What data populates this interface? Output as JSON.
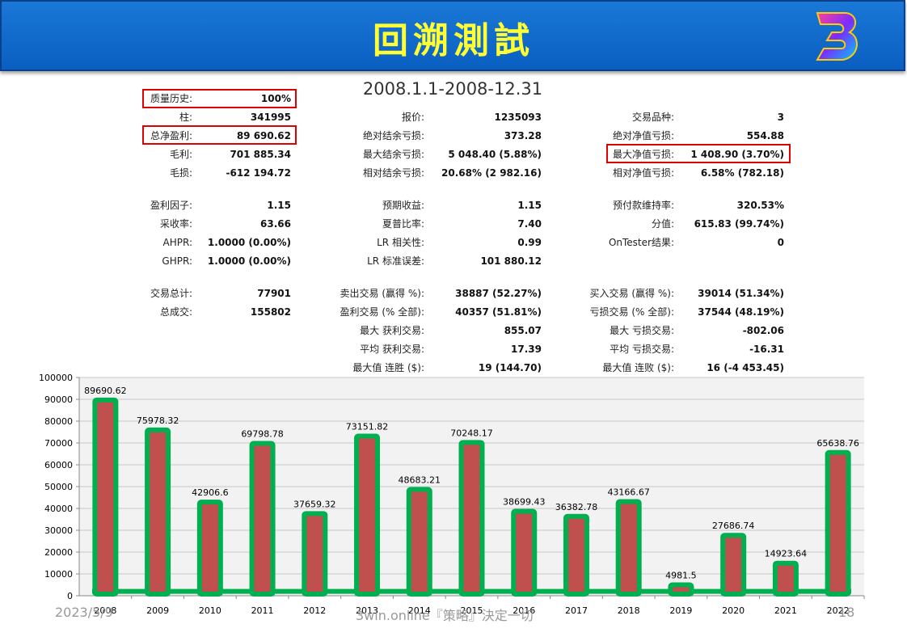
{
  "header": {
    "title": "回溯測試"
  },
  "period": "2008.1.1-2008-12.31",
  "stats": [
    {
      "key": "quality",
      "label": "质量历史:",
      "value": "100%"
    },
    {
      "key": "bars",
      "label": "柱:",
      "value": "341995"
    },
    {
      "key": "net_profit",
      "label": "总净盈利:",
      "value": "89 690.62"
    },
    {
      "key": "gross_profit",
      "label": "毛利:",
      "value": "701 885.34"
    },
    {
      "key": "gross_loss",
      "label": "毛损:",
      "value": "-612 194.72"
    },
    {
      "key": "ticks",
      "label": "报价:",
      "value": "1235093"
    },
    {
      "key": "abs_balance_dd",
      "label": "绝对结余亏损:",
      "value": "373.28"
    },
    {
      "key": "max_balance_dd",
      "label": "最大结余亏损:",
      "value": "5 048.40 (5.88%)"
    },
    {
      "key": "rel_balance_dd",
      "label": "相对结余亏损:",
      "value": "20.68% (2 982.16)"
    },
    {
      "key": "symbols",
      "label": "交易品种:",
      "value": "3"
    },
    {
      "key": "abs_equity_dd",
      "label": "绝对净值亏损:",
      "value": "554.88"
    },
    {
      "key": "max_equity_dd",
      "label": "最大净值亏损:",
      "value": "1 408.90 (3.70%)"
    },
    {
      "key": "rel_equity_dd",
      "label": "相对净值亏损:",
      "value": "6.58% (782.18)"
    },
    {
      "key": "profit_factor",
      "label": "盈利因子:",
      "value": "1.15"
    },
    {
      "key": "recovery",
      "label": "采收率:",
      "value": "63.66"
    },
    {
      "key": "ahpr",
      "label": "AHPR:",
      "value": "1.0000 (0.00%)"
    },
    {
      "key": "ghpr",
      "label": "GHPR:",
      "value": "1.0000 (0.00%)"
    },
    {
      "key": "expected_payoff",
      "label": "预期收益:",
      "value": "1.15"
    },
    {
      "key": "sharpe",
      "label": "夏普比率:",
      "value": "7.40"
    },
    {
      "key": "lr_corr",
      "label": "LR 相关性:",
      "value": "0.99"
    },
    {
      "key": "lr_err",
      "label": "LR 标准误差:",
      "value": "101 880.12"
    },
    {
      "key": "margin_level",
      "label": "预付款维持率:",
      "value": "320.53%"
    },
    {
      "key": "z_score",
      "label": "分值:",
      "value": "615.83 (99.74%)"
    },
    {
      "key": "ontester",
      "label": "OnTester结果:",
      "value": "0"
    },
    {
      "key": "total_trades",
      "label": "交易总计:",
      "value": "77901"
    },
    {
      "key": "total_deals",
      "label": "总成交:",
      "value": "155802"
    },
    {
      "key": "short_trades",
      "label": "卖出交易 (赢得 %):",
      "value": "38887 (52.27%)"
    },
    {
      "key": "profit_trades",
      "label": "盈利交易 (% 全部):",
      "value": "40357 (51.81%)"
    },
    {
      "key": "largest_profit",
      "label": "最大 获利交易:",
      "value": "855.07"
    },
    {
      "key": "avg_profit",
      "label": "平均 获利交易:",
      "value": "17.39"
    },
    {
      "key": "max_cons_wins",
      "label": "最大值 连胜 ($):",
      "value": "19 (144.70)"
    },
    {
      "key": "long_trades",
      "label": "买入交易 (赢得 %):",
      "value": "39014 (51.34%)"
    },
    {
      "key": "loss_trades",
      "label": "亏损交易 (% 全部):",
      "value": "37544 (48.19%)"
    },
    {
      "key": "largest_loss",
      "label": "最大 亏损交易:",
      "value": "-802.06"
    },
    {
      "key": "avg_loss",
      "label": "平均 亏损交易:",
      "value": "-16.31"
    },
    {
      "key": "max_cons_losses",
      "label": "最大值 连败 ($):",
      "value": "16 (-4 453.45)"
    }
  ],
  "chart_data": {
    "type": "bar",
    "categories": [
      "2008",
      "2009",
      "2010",
      "2011",
      "2012",
      "2013",
      "2014",
      "2015",
      "2016",
      "2017",
      "2018",
      "2019",
      "2020",
      "2021",
      "2022"
    ],
    "values": [
      89690.62,
      75978.32,
      42906.6,
      69798.78,
      37659.32,
      73151.82,
      48683.21,
      70248.17,
      38699.43,
      36382.78,
      43166.67,
      4981.5,
      27686.74,
      14923.64,
      65638.76
    ],
    "data_labels": [
      "89690.62",
      "75978.32",
      "42906.6",
      "69798.78",
      "37659.32",
      "73151.82",
      "48683.21",
      "70248.17",
      "38699.43",
      "36382.78",
      "43166.67",
      "4981.5",
      "27686.74",
      "14923.64",
      "65638.76"
    ],
    "yticks": [
      "0",
      "10000",
      "20000",
      "30000",
      "40000",
      "50000",
      "60000",
      "70000",
      "80000",
      "90000",
      "100000"
    ],
    "ylim": [
      0,
      100000
    ],
    "grid": true,
    "colors": {
      "bar_fill": "#c0504d",
      "bar_outline": "#00b050",
      "plot_bg": "#f2f2f2"
    }
  },
  "footer": {
    "date": "2023/5/9",
    "slogan": "3win.online『策略』決定一切",
    "page": "18"
  },
  "colors": {
    "banner": "#1a78d6",
    "title": "#ffff33",
    "highlight": "#e00000"
  }
}
